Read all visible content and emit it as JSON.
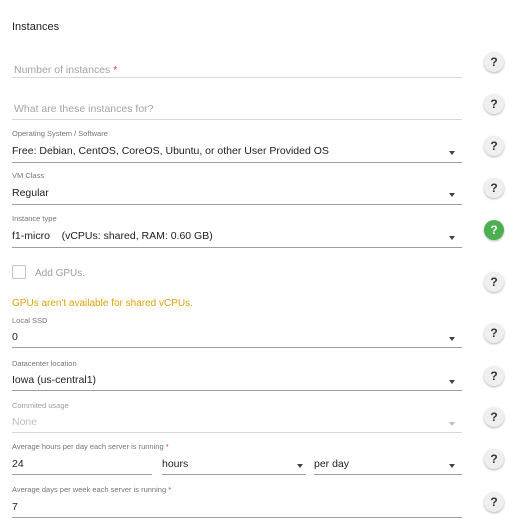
{
  "section_title": "Instances",
  "fields": {
    "num_instances": {
      "placeholder": "Number of instances",
      "required_mark": "*"
    },
    "purpose": {
      "placeholder": "What are these instances for?"
    },
    "os": {
      "label": "Operating System / Software",
      "value": "Free: Debian, CentOS, CoreOS, Ubuntu, or other User Provided OS"
    },
    "vm_class": {
      "label": "VM Class",
      "value": "Regular"
    },
    "instance_type": {
      "label": "Instance type",
      "value": "f1-micro    (vCPUs: shared, RAM: 0.60 GB)"
    },
    "add_gpus": {
      "label": "Add GPUs.",
      "checked": false,
      "warning": "GPUs aren't available for shared vCPUs."
    },
    "local_ssd": {
      "label": "Local SSD",
      "value": "0"
    },
    "datacenter": {
      "label": "Datacenter location",
      "value": "Iowa (us-central1)"
    },
    "committed_usage": {
      "label": "Commited usage",
      "value": "None"
    },
    "hours_per_day": {
      "label": "Average hours per day each server is running",
      "required_mark": "*",
      "value": "24",
      "unit": "hours",
      "period": "per day"
    },
    "days_per_week": {
      "label": "Average days per week each server is running",
      "required_mark": "*",
      "value": "7"
    }
  },
  "help_icon": "?",
  "colors": {
    "help_active": "#4caf50",
    "warning": "#e0a20c",
    "required": "#e53935"
  }
}
